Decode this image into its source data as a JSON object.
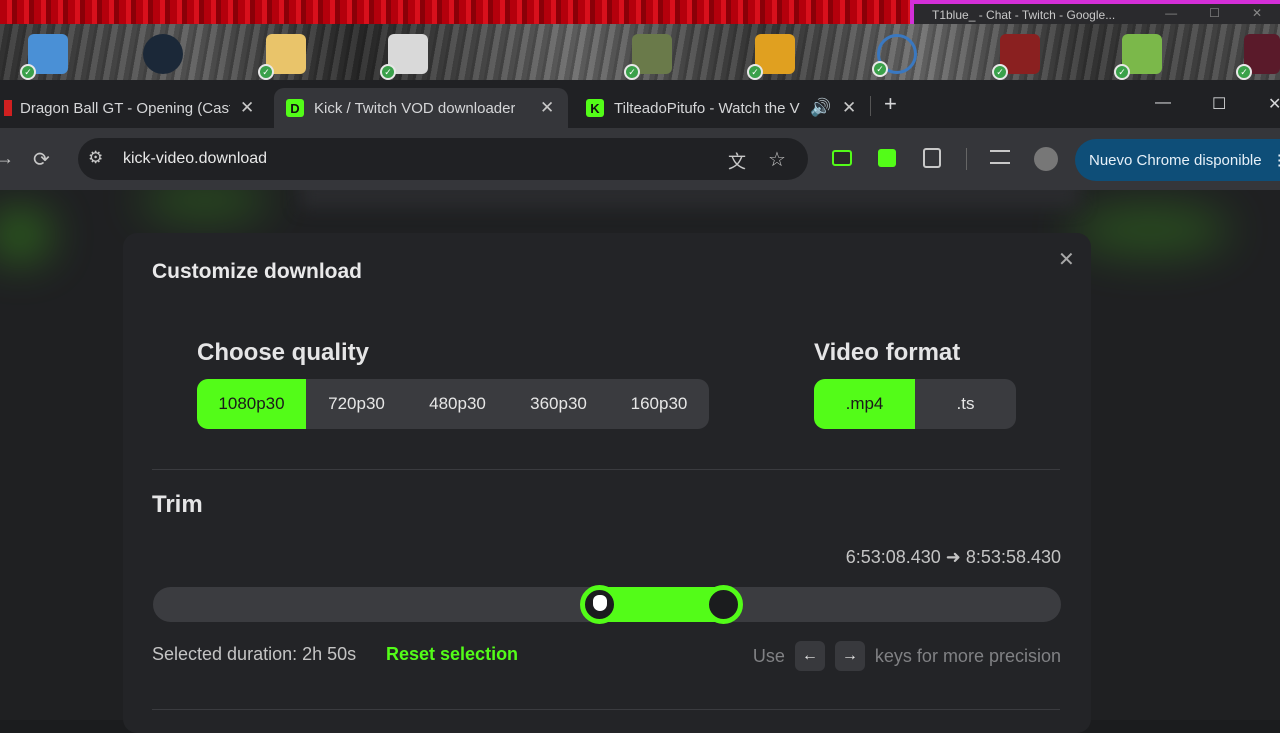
{
  "desktop": {
    "window_title": "T1blue_ - Chat - Twitch - Google...",
    "window_controls": [
      "—",
      "☐",
      "✕"
    ]
  },
  "tabs": [
    {
      "title": "Dragon Ball GT - Opening (Castellano)",
      "close": "✕"
    },
    {
      "title": "Kick / Twitch VOD downloader",
      "favicon": "D",
      "close": "✕",
      "active": true
    },
    {
      "title": "TilteadoPitufo - Watch the VOD",
      "favicon": "K",
      "close": "✕",
      "audio": "🔊"
    }
  ],
  "window_controls": {
    "new_tab": "+",
    "minimize": "—",
    "maximize": "☐",
    "close": "✕"
  },
  "toolbar": {
    "back": "→",
    "reload": "⟳",
    "site_info": "⚙",
    "url": "kick-video.download",
    "translate": "文",
    "bookmark": "☆",
    "update_label": "Nuevo Chrome disponible",
    "menu": "⋮"
  },
  "modal": {
    "title": "Customize download",
    "close": "✕",
    "quality": {
      "heading": "Choose quality",
      "options": [
        "1080p30",
        "720p30",
        "480p30",
        "360p30",
        "160p30"
      ],
      "selected": "1080p30"
    },
    "format": {
      "heading": "Video format",
      "options": [
        ".mp4",
        ".ts"
      ],
      "selected": ".mp4"
    },
    "trim": {
      "heading": "Trim",
      "start": "6:53:08.430",
      "arrow": "➜",
      "end": "8:53:58.430",
      "selection_start": 0.49,
      "selection_end": 0.627,
      "duration_text": "Selected duration: 2h 50s",
      "reset_label": "Reset selection",
      "hint_use": "Use",
      "key_left": "←",
      "key_right": "→",
      "hint_rest": "keys for more precision"
    }
  },
  "colors": {
    "accent": "#53fc18",
    "update": "#0e4e78"
  }
}
